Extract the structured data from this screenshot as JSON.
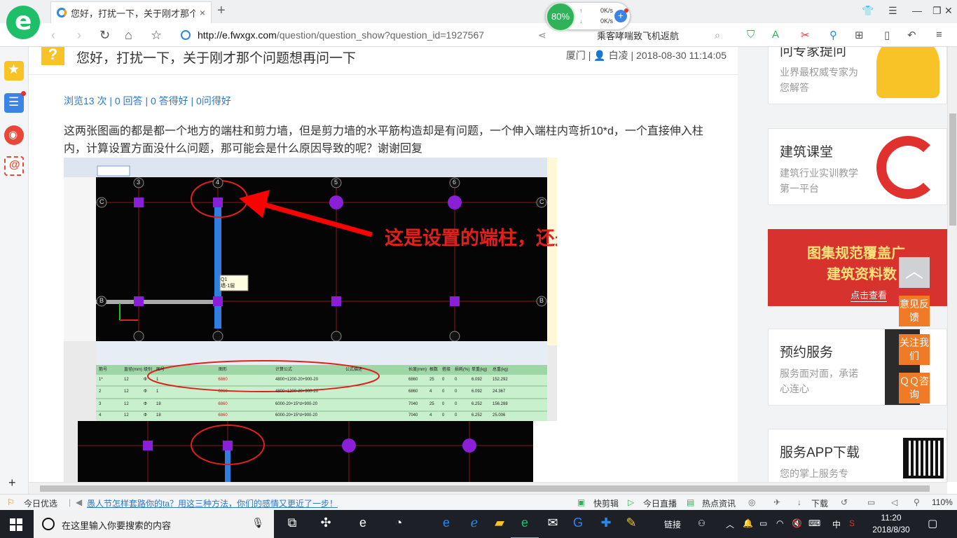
{
  "browser": {
    "tab_title": "您好，打扰一下，关于刚才那个问",
    "tab_close": "×",
    "new_tab": "+",
    "net_percent": "80%",
    "net_up": "0K/s",
    "net_down": "0K/s",
    "net_plus": "+",
    "address_host": "http://e.fwxgx.com",
    "address_path": "/question/question_show?question_id=1927567",
    "hot_search": "乘客哮喘致飞机返航",
    "colors": {
      "accent": "#1fbf6a",
      "link": "#2b78c9"
    }
  },
  "question": {
    "badge": "?",
    "title": "您好，打扰一下，关于刚才那个问题想再问一下",
    "location": "厦门",
    "user": "白凌",
    "datetime": "2018-08-30 11:14:05",
    "stats": "浏览13 次 | 0 回答 | 0 答得好 | 0问得好",
    "body": "这两张图画的都是都一个地方的端柱和剪力墙，但是剪力墙的水平筋构造却是有问题，一个伸入端柱内弯折10*d，一个直接伸入柱内，计算设置方面没什么问题，那可能会是什么原因导致的呢？谢谢回复"
  },
  "screenshot": {
    "annotation": "这是设置的端柱，还是框架柱",
    "axis_top": [
      "3",
      "4",
      "5",
      "6"
    ],
    "axis_side_c": "C",
    "axis_side_b": "B",
    "tooltip_line1": "Q1",
    "tooltip_line2": "墙-1层",
    "row_numbers": [
      "1*",
      "2",
      "3",
      "4"
    ],
    "table_headers": [
      "筋号",
      "直径(mm)",
      "级别",
      "图号",
      "图形",
      "计算公式",
      "公式描述",
      "长度(mm)",
      "根数",
      "搭接",
      "损耗(%)",
      "单重(kg)",
      "总重(kg)"
    ],
    "rows": [
      {
        "dia": "12",
        "grade": "Φ",
        "fig": "1",
        "shape": "6860",
        "formula": "4800+1200-20+900-20",
        "len": "6860",
        "count": "25",
        "lap": "0",
        "loss": "0",
        "unit": "6.092",
        "total": "152.292"
      },
      {
        "dia": "12",
        "grade": "Φ",
        "fig": "1",
        "shape": "6860",
        "formula": "4800+1200-20+900-20",
        "len": "6860",
        "count": "4",
        "lap": "0",
        "loss": "0",
        "unit": "6.092",
        "total": "24.367"
      },
      {
        "dia": "12",
        "grade": "Φ",
        "fig": "18",
        "shape": "6860",
        "formula": "6000-20+15*d+900-20",
        "len": "7040",
        "count": "25",
        "lap": "0",
        "loss": "0",
        "unit": "6.252",
        "total": "156.288"
      },
      {
        "dia": "12",
        "grade": "Φ",
        "fig": "18",
        "shape": "6860",
        "formula": "6000-20+15*d+900-20",
        "len": "7040",
        "count": "4",
        "lap": "0",
        "loss": "0",
        "unit": "6.252",
        "total": "25.006"
      }
    ]
  },
  "sidebar_right": {
    "expert_title": "问专家提问",
    "expert_desc": "业界最权威专家为您解答",
    "course_title": "建筑课堂",
    "course_desc": "建筑行业实训教学第一平台",
    "promo_line1": "图集规范覆盖广",
    "promo_line2": "建筑资料数",
    "promo_link": "点击查看",
    "booking_title": "预约服务",
    "booking_desc": "服务面对面，承诺心连心",
    "app_title": "服务APP下载",
    "app_desc": "您的掌上服务专",
    "float_top": "︿",
    "float_feedback": "意见反馈",
    "float_follow": "关注我们",
    "float_qq": "ＱＱ咨询"
  },
  "statusbar": {
    "today": "今日优选",
    "news": "愚人节怎样套路你的ta？用这三种方法，你们的感情又更近了一步！",
    "kuaijianji": "快剪辑",
    "live": "今日直播",
    "hot_news": "热点资讯",
    "download": "下载",
    "zoom": "110%"
  },
  "taskbar": {
    "search_placeholder": "在这里输入你要搜索的内容",
    "link": "链接",
    "ime": "中",
    "time": "11:20",
    "date": "2018/8/30"
  }
}
